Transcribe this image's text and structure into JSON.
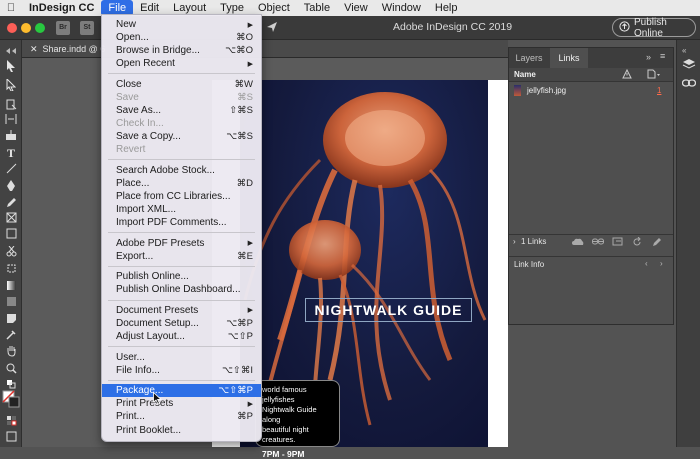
{
  "menubar": {
    "app_name": "InDesign CC",
    "menus": [
      "File",
      "Edit",
      "Layout",
      "Type",
      "Object",
      "Table",
      "View",
      "Window",
      "Help"
    ]
  },
  "appbar": {
    "badges": [
      "Br",
      "St"
    ],
    "title": "Adobe InDesign CC 2019",
    "publish_label": "Publish Online"
  },
  "tab": {
    "label": "Share.indd @ 6"
  },
  "file_menu": {
    "items": [
      {
        "label": "New",
        "shortcut": "",
        "submenu": true,
        "disabled": false
      },
      {
        "label": "Open...",
        "shortcut": "⌘O",
        "submenu": false,
        "disabled": false
      },
      {
        "label": "Browse in Bridge...",
        "shortcut": "⌥⌘O",
        "submenu": false,
        "disabled": false
      },
      {
        "label": "Open Recent",
        "shortcut": "",
        "submenu": true,
        "disabled": false,
        "sep_after": true
      },
      {
        "label": "Close",
        "shortcut": "⌘W",
        "submenu": false,
        "disabled": false
      },
      {
        "label": "Save",
        "shortcut": "⌘S",
        "submenu": false,
        "disabled": true
      },
      {
        "label": "Save As...",
        "shortcut": "⇧⌘S",
        "submenu": false,
        "disabled": false
      },
      {
        "label": "Check In...",
        "shortcut": "",
        "submenu": false,
        "disabled": true
      },
      {
        "label": "Save a Copy...",
        "shortcut": "⌥⌘S",
        "submenu": false,
        "disabled": false
      },
      {
        "label": "Revert",
        "shortcut": "",
        "submenu": false,
        "disabled": true,
        "sep_after": true
      },
      {
        "label": "Search Adobe Stock...",
        "shortcut": "",
        "submenu": false,
        "disabled": false
      },
      {
        "label": "Place...",
        "shortcut": "⌘D",
        "submenu": false,
        "disabled": false
      },
      {
        "label": "Place from CC Libraries...",
        "shortcut": "",
        "submenu": false,
        "disabled": false
      },
      {
        "label": "Import XML...",
        "shortcut": "",
        "submenu": false,
        "disabled": false
      },
      {
        "label": "Import PDF Comments...",
        "shortcut": "",
        "submenu": false,
        "disabled": false,
        "sep_after": true
      },
      {
        "label": "Adobe PDF Presets",
        "shortcut": "",
        "submenu": true,
        "disabled": false
      },
      {
        "label": "Export...",
        "shortcut": "⌘E",
        "submenu": false,
        "disabled": false,
        "sep_after": true
      },
      {
        "label": "Publish Online...",
        "shortcut": "",
        "submenu": false,
        "disabled": false
      },
      {
        "label": "Publish Online Dashboard...",
        "shortcut": "",
        "submenu": false,
        "disabled": false,
        "sep_after": true
      },
      {
        "label": "Document Presets",
        "shortcut": "",
        "submenu": true,
        "disabled": false
      },
      {
        "label": "Document Setup...",
        "shortcut": "⌥⌘P",
        "submenu": false,
        "disabled": false
      },
      {
        "label": "Adjust Layout...",
        "shortcut": "⌥⇧P",
        "submenu": false,
        "disabled": false,
        "sep_after": true
      },
      {
        "label": "User...",
        "shortcut": "",
        "submenu": false,
        "disabled": false
      },
      {
        "label": "File Info...",
        "shortcut": "⌥⇧⌘I",
        "submenu": false,
        "disabled": false,
        "sep_after": true
      },
      {
        "label": "Package...",
        "shortcut": "⌥⇧⌘P",
        "submenu": false,
        "disabled": false,
        "highlighted": true
      },
      {
        "label": "Print Presets",
        "shortcut": "",
        "submenu": true,
        "disabled": false
      },
      {
        "label": "Print...",
        "shortcut": "⌘P",
        "submenu": false,
        "disabled": false
      },
      {
        "label": "Print Booklet...",
        "shortcut": "",
        "submenu": false,
        "disabled": false
      }
    ]
  },
  "panel": {
    "tabs": [
      "Layers",
      "Links"
    ],
    "active_tab": "Links",
    "column_name": "Name",
    "links": [
      {
        "name": "jellyfish.jpg",
        "page": "1"
      }
    ],
    "links_count": "1 Links",
    "link_info_label": "Link Info"
  },
  "document": {
    "title": "NIGHTWALK GUIDE",
    "caption_lines": [
      "world famous jellyfishes",
      "Nightwalk Guide along",
      "beautiful night creatures."
    ],
    "caption_time": "7PM - 9PM"
  },
  "colors": {
    "menu_highlight": "#2d6fe6",
    "menubar_active": "#2f6ee6",
    "artwork_bg": "#141a3d",
    "jelly": "#d5673a"
  }
}
